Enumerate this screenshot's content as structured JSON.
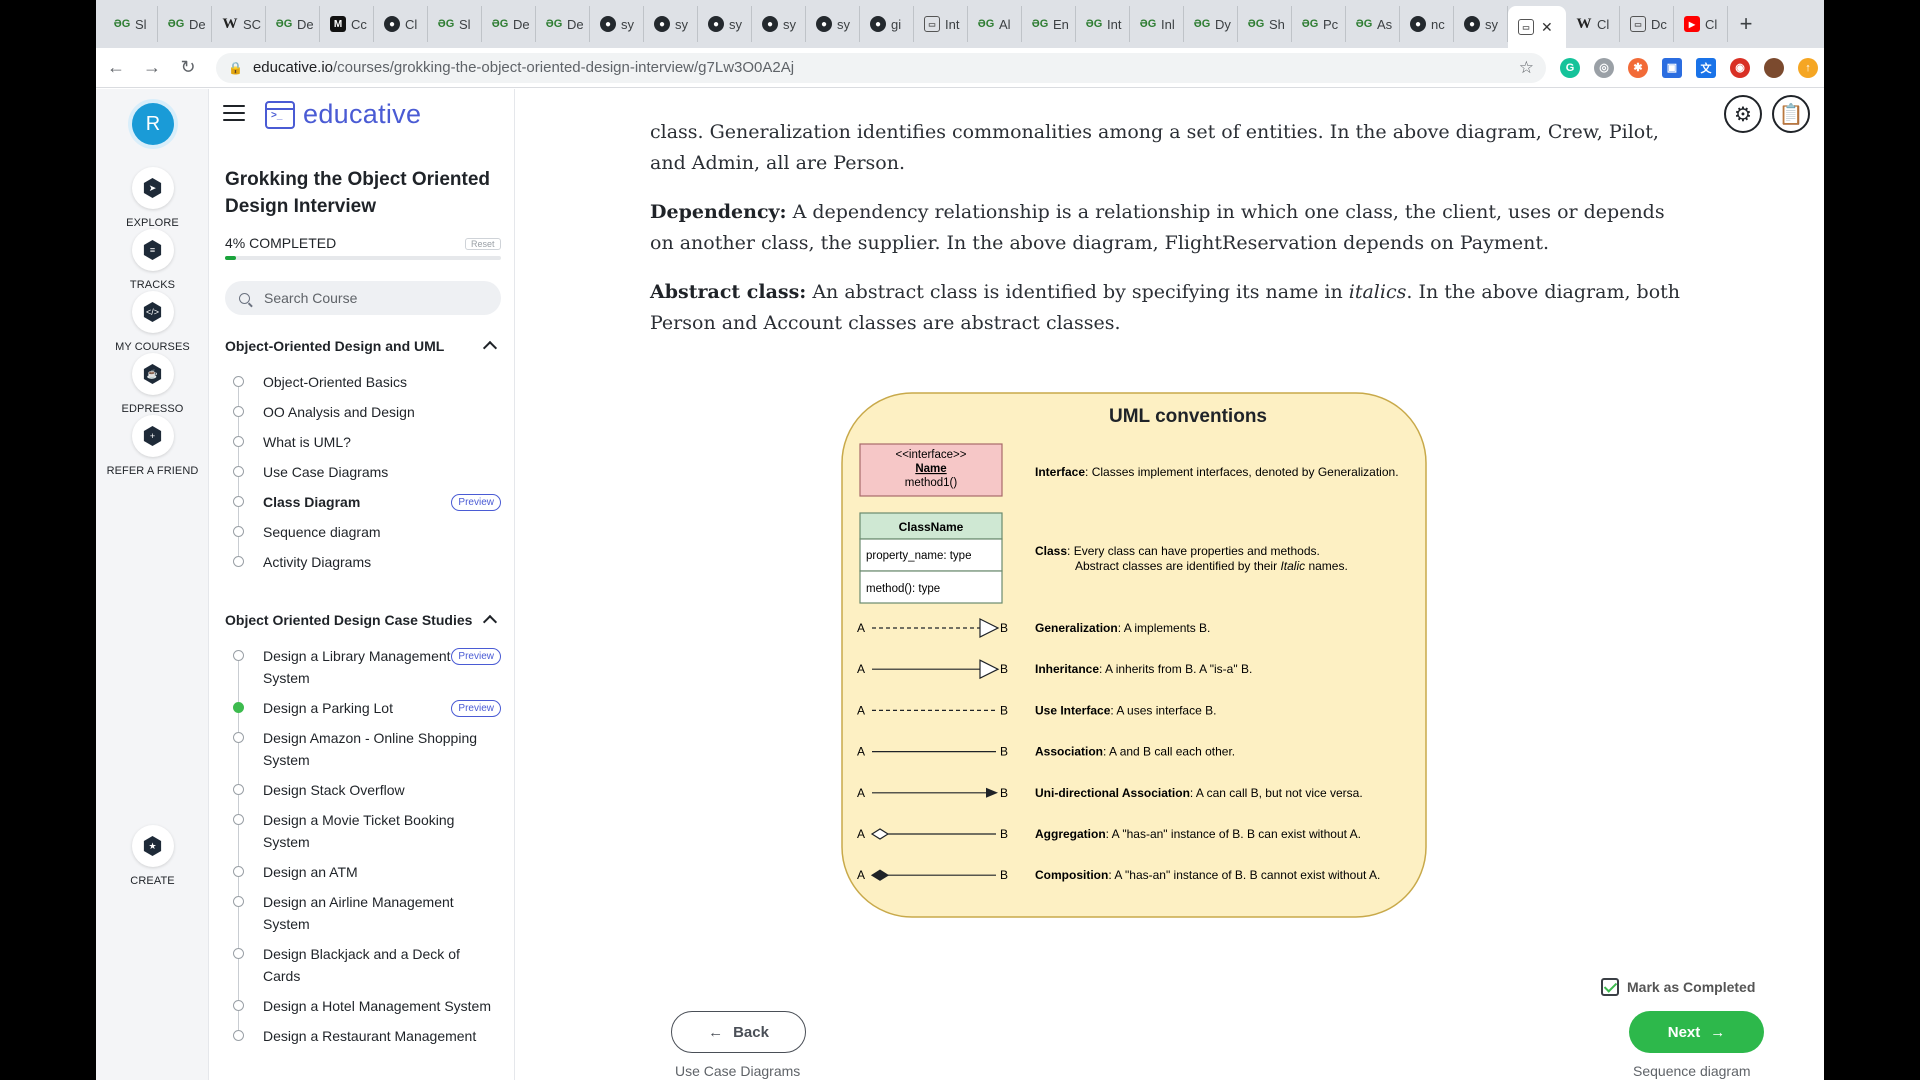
{
  "browser": {
    "tabs": [
      {
        "icon": "gg",
        "label": "Sl"
      },
      {
        "icon": "gg",
        "label": "De"
      },
      {
        "icon": "w",
        "label": "SC"
      },
      {
        "icon": "gg",
        "label": "De"
      },
      {
        "icon": "m",
        "label": "Cc"
      },
      {
        "icon": "gh",
        "label": "Cl"
      },
      {
        "icon": "gg",
        "label": "Sl"
      },
      {
        "icon": "gg",
        "label": "De"
      },
      {
        "icon": "gg",
        "label": "De"
      },
      {
        "icon": "gh",
        "label": "sy"
      },
      {
        "icon": "gh",
        "label": "sy"
      },
      {
        "icon": "gh",
        "label": "sy"
      },
      {
        "icon": "gh",
        "label": "sy"
      },
      {
        "icon": "gh",
        "label": "sy"
      },
      {
        "icon": "gh",
        "label": "gi"
      },
      {
        "icon": "ed",
        "label": "Int"
      },
      {
        "icon": "gg",
        "label": "Al"
      },
      {
        "icon": "gg",
        "label": "En"
      },
      {
        "icon": "gg",
        "label": "Int"
      },
      {
        "icon": "gg",
        "label": "Inl"
      },
      {
        "icon": "gg",
        "label": "Dy"
      },
      {
        "icon": "gg",
        "label": "Sh"
      },
      {
        "icon": "gg",
        "label": "Pc"
      },
      {
        "icon": "gg",
        "label": "As"
      },
      {
        "icon": "gh",
        "label": "nc"
      },
      {
        "icon": "gh",
        "label": "sy"
      },
      {
        "icon": "ed",
        "label": "",
        "active": true
      },
      {
        "icon": "w",
        "label": "Cl"
      },
      {
        "icon": "ed",
        "label": "Dc"
      },
      {
        "icon": "yt",
        "label": "Cl"
      }
    ],
    "url_host": "educative.io",
    "url_path": "/courses/grokking-the-object-oriented-design-interview/g7Lw3O0A2Aj"
  },
  "rail": {
    "avatar_letter": "R",
    "items": [
      {
        "label": "EXPLORE",
        "icon": "compass-icon",
        "glyph": "➤"
      },
      {
        "label": "TRACKS",
        "icon": "tracks-icon",
        "glyph": "≡"
      },
      {
        "label": "MY COURSES",
        "icon": "code-icon",
        "glyph": "</>"
      },
      {
        "label": "EDPRESSO",
        "icon": "coffee-icon",
        "glyph": "☕"
      },
      {
        "label": "REFER A FRIEND",
        "icon": "add-user-icon",
        "glyph": "+"
      },
      {
        "label": "CREATE",
        "icon": "star-icon",
        "glyph": "★"
      }
    ]
  },
  "sidebar": {
    "logo": "educative",
    "course_title": "Grokking the Object Oriented Design Interview",
    "progress_label": "4% COMPLETED",
    "progress_fraction": 0.04,
    "reset_label": "Reset",
    "search_placeholder": "Search Course",
    "sections": [
      {
        "title": "Object-Oriented Design and UML",
        "lessons": [
          {
            "label": "Object-Oriented Basics"
          },
          {
            "label": "OO Analysis and Design"
          },
          {
            "label": "What is UML?"
          },
          {
            "label": "Use Case Diagrams"
          },
          {
            "label": "Class Diagram",
            "preview": "Preview",
            "current": true
          },
          {
            "label": "Sequence diagram"
          },
          {
            "label": "Activity Diagrams"
          }
        ]
      },
      {
        "title": "Object Oriented Design Case Studies",
        "lessons": [
          {
            "label": "Design a Library Management System",
            "preview": "Preview"
          },
          {
            "label": "Design a Parking Lot",
            "preview": "Preview",
            "done": true
          },
          {
            "label": "Design Amazon - Online Shopping System"
          },
          {
            "label": "Design Stack Overflow"
          },
          {
            "label": "Design a Movie Ticket Booking System"
          },
          {
            "label": "Design an ATM"
          },
          {
            "label": "Design an Airline Management System"
          },
          {
            "label": "Design Blackjack and a Deck of Cards"
          },
          {
            "label": "Design a Hotel Management System"
          },
          {
            "label": "Design a Restaurant Management"
          }
        ]
      }
    ]
  },
  "article": {
    "p1": "class. Generalization identifies commonalities among a set of entities. In the above diagram, Crew, Pilot, and Admin, all are Person.",
    "p2_term": "Dependency:",
    "p2": " A dependency relationship is a relationship in which one class, the client, uses or depends on another class, the supplier. In the above diagram, FlightReservation depends on Payment.",
    "p3_term": "Abstract class:",
    "p3_a": " An abstract class is identified by specifying its name in ",
    "p3_em": "italics",
    "p3_b": ". In the above diagram, both Person and Account classes are abstract classes."
  },
  "uml": {
    "title": "UML conventions",
    "interface_box": {
      "stereotype": "<<interface>>",
      "name": "Name",
      "method": "method1()"
    },
    "interface_desc_term": "Interface",
    "interface_desc": ": Classes implement interfaces, denoted by Generalization.",
    "class_box": {
      "name": "ClassName",
      "property": "property_name: type",
      "method": "method(): type"
    },
    "class_desc_term": "Class",
    "class_desc_1": ": Every class can have properties and methods.",
    "class_desc_2a": "Abstract classes are identified by their ",
    "class_desc_2em": "Italic",
    "class_desc_2b": " names.",
    "end_a": "A",
    "end_b": "B",
    "relations": [
      {
        "term": "Generalization",
        "desc": ": A implements B.",
        "line": "dashed",
        "head": "hollow-triangle"
      },
      {
        "term": "Inheritance",
        "desc": ": A inherits from B. A \"is-a\" B.",
        "line": "solid",
        "head": "hollow-triangle"
      },
      {
        "term": "Use Interface",
        "desc": ": A uses interface B.",
        "line": "dashed",
        "head": "none"
      },
      {
        "term": "Association",
        "desc": ": A and B call each other.",
        "line": "solid",
        "head": "none"
      },
      {
        "term": "Uni-directional Association",
        "desc": ": A can call B, but not vice versa.",
        "line": "solid",
        "head": "filled-arrow"
      },
      {
        "term": "Aggregation",
        "desc": ": A \"has-an\" instance of B. B can exist without A.",
        "line": "solid",
        "head": "hollow-diamond"
      },
      {
        "term": "Composition",
        "desc": ": A \"has-an\" instance of B. B cannot exist without A.",
        "line": "solid",
        "head": "filled-diamond"
      }
    ]
  },
  "footer": {
    "mark_completed": "Mark as Completed",
    "back_label": "Back",
    "next_label": "Next",
    "prev_lesson": "Use Case Diagrams",
    "next_lesson": "Sequence diagram"
  },
  "colors": {
    "accent": "#4a5bd4",
    "green": "#2db84b",
    "uml_bg": "#fdf0c3",
    "uml_border": "#c8a94a",
    "interface_fill": "#f6c7c7",
    "class_fill": "#cfe8d3"
  }
}
